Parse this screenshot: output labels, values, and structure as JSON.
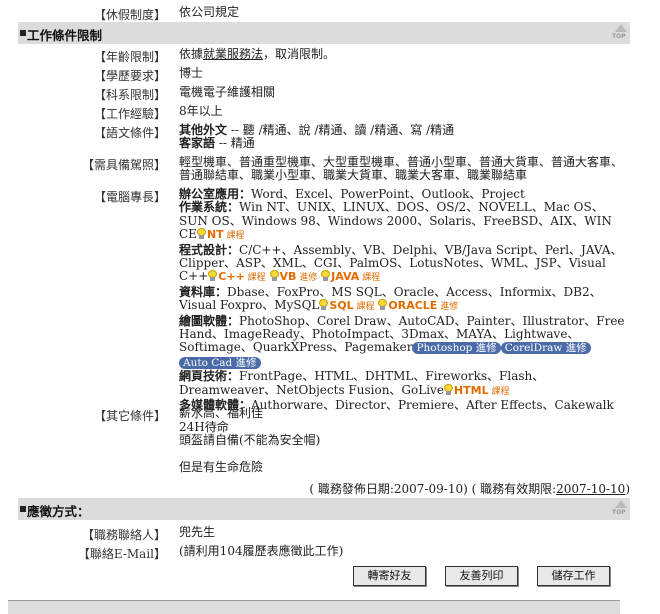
{
  "vacation": {
    "label": "【休假制度】",
    "value": "依公司規定"
  },
  "section_conditions": {
    "title": "工作條件限制",
    "top": "TOP"
  },
  "age": {
    "label": "【年齡限制】",
    "value_pre": "依據",
    "value_link": "就業服務法",
    "value_post": "，取消限制。"
  },
  "education": {
    "label": "【學歷要求】",
    "value": "博士"
  },
  "major": {
    "label": "【科系限制】",
    "value": "電機電子維護相關"
  },
  "experience": {
    "label": "【工作經驗】",
    "value": "8年以上"
  },
  "language": {
    "label": "【語文條件】",
    "lines": [
      {
        "name": "其他外文",
        "text": " -- 聽 /精通、說 /精通、讀 /精通、寫 /精通"
      },
      {
        "name": "客家語",
        "text": " -- 精通"
      }
    ]
  },
  "license": {
    "label": "【需具備駕照】",
    "value": "輕型機車、普通重型機車、大型重型機車、普通小型車、普通大貨車、普通大客車、普通聯結車、職業小型車、職業大貨車、職業大客車、職業聯結車"
  },
  "computer": {
    "label": "【電腦專長】",
    "office": {
      "name": "辦公室應用：",
      "text": "Word、Excel、PowerPoint、Outlook、Project"
    },
    "os": {
      "name": "作業系統：",
      "text": "Win NT、UNIX、LINUX、DOS、OS/2、NOVELL、Mac OS、SUN OS、Windows 98、Windows 2000、Solaris、FreeBSD、AIX、WIN CE",
      "c1": "NT",
      "c1s": " 課程"
    },
    "prog": {
      "name": "程式設計：",
      "text": "C/C++、Assembly、VB、Delphi、VB/Java Script、Perl、JAVA、Clipper、ASP、XML、CGI、PalmOS、LotusNotes、WML、JSP、Visual C++",
      "c1": "C++",
      "c1s": " 課程",
      "c2": "VB",
      "c2s": " 進修",
      "c3": "JAVA",
      "c3s": " 課程"
    },
    "db": {
      "name": "資料庫：",
      "text": "Dbase、FoxPro、MS SQL、Oracle、Access、Informix、DB2、Visual Foxpro、MySQL",
      "c1": "SQL",
      "c1s": " 課程",
      "c2": "ORACLE",
      "c2s": " 進修"
    },
    "graphics": {
      "name": "繪圖軟體：",
      "text": "PhotoShop、Corel Draw、AutoCAD、Painter、Illustrator、Free Hand、ImageReady、PhotoImpact、3Dmax、MAYA、Lightwave、Softimage、QuarkXPress、Pagemaker",
      "p1": "Photoshop 進修",
      "p2": "CorelDraw 進修",
      "p3": "Auto Cad 進修"
    },
    "web": {
      "name": "網頁技術：",
      "text": "FrontPage、HTML、DHTML、Fireworks、Flash、Dreamweaver、NetObjects Fusion、GoLive",
      "c1": "HTML",
      "c1s": " 課程"
    },
    "mm": {
      "name": "多媒體軟體：",
      "text": "Authorware、Director、Premiere、After Effects、Cakewalk"
    }
  },
  "other": {
    "label": "【其它條件】",
    "lines": [
      "薪水高、福利佳",
      "24H待命",
      "頭盔請自備(不能為安全帽)",
      "",
      "但是有生命危險"
    ]
  },
  "dates": {
    "pre": "( 職務發佈日期:2007-09-10) ( 職務有效期限:",
    "link": "2007-10-10",
    "post": ")"
  },
  "section_apply": {
    "title": "應徵方式：",
    "top": "TOP"
  },
  "contact": {
    "label": "【職務聯絡人】",
    "value": "兜先生"
  },
  "email": {
    "label": "【聯絡E-Mail】",
    "value": "(請利用104履歷表應徵此工作)"
  },
  "buttons": {
    "forward": "轉寄好友",
    "print": "友善列印",
    "save": "儲存工作"
  }
}
